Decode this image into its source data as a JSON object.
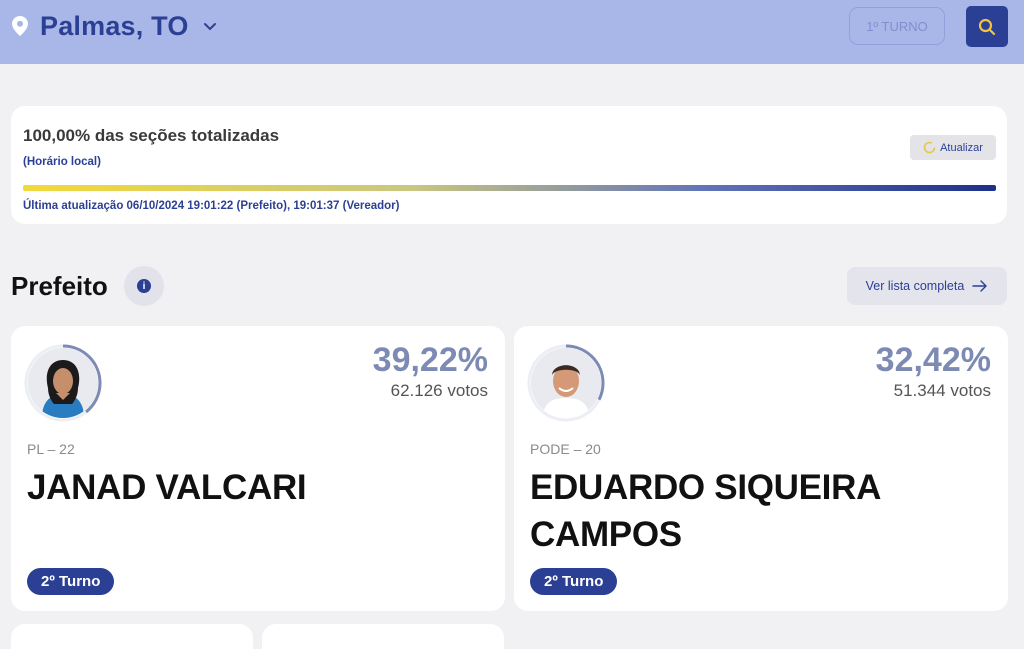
{
  "header": {
    "location": "Palmas, TO",
    "turno_label": "1º TURNO"
  },
  "status": {
    "title": "100,00% das seções totalizadas",
    "subtitle": "(Horário local)",
    "refresh_label": "Atualizar",
    "progress_percent": 100,
    "last_update": "Última atualização 06/10/2024 19:01:22 (Prefeito), 19:01:37 (Vereador)"
  },
  "section": {
    "title": "Prefeito",
    "list_button": "Ver lista completa"
  },
  "candidates": [
    {
      "percent": "39,22%",
      "votes": "62.126 votos",
      "party": "PL – 22",
      "name": "JANAD VALCARI",
      "badge": "2º Turno",
      "share": 0.3922
    },
    {
      "percent": "32,42%",
      "votes": "51.344 votos",
      "party": "PODE – 20",
      "name": "EDUARDO SIQUEIRA CAMPOS",
      "badge": "2º Turno",
      "share": 0.3242
    }
  ],
  "colors": {
    "header_bg": "#a9b7e8",
    "brand": "#2b3f94",
    "percent": "#7d8ab3",
    "page_bg": "#f1f0f3"
  },
  "icons": {
    "location": "location-pin-icon",
    "chevron": "chevron-down-icon",
    "search": "search-icon",
    "refresh": "refresh-icon",
    "info": "info-icon",
    "arrow": "arrow-right-icon"
  }
}
